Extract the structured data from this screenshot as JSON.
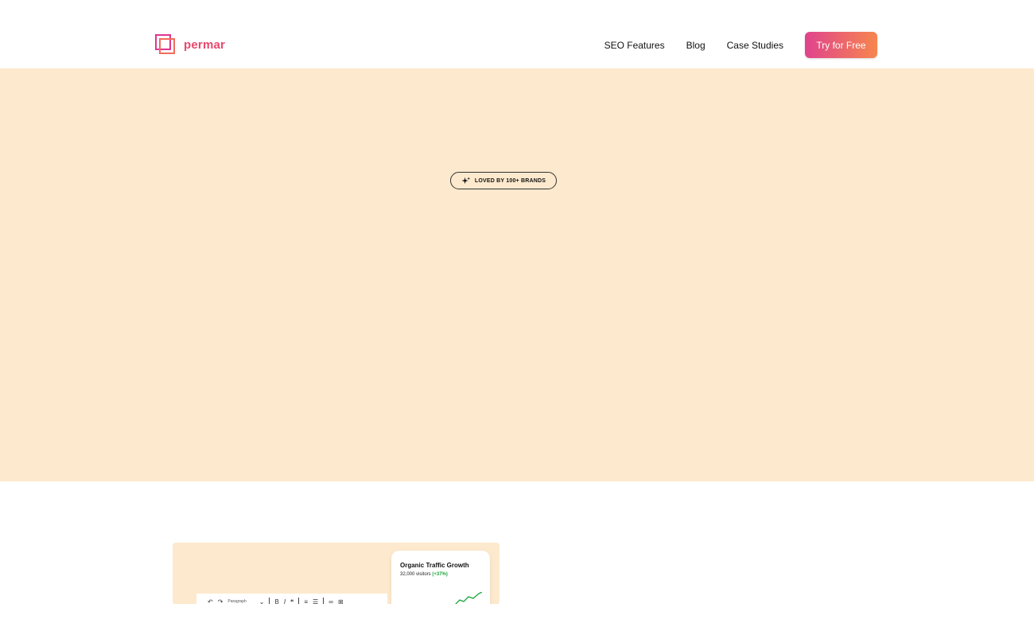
{
  "header": {
    "logo_text": "permar",
    "nav": [
      {
        "label": "SEO Features"
      },
      {
        "label": "Blog"
      },
      {
        "label": "Case Studies"
      }
    ],
    "cta_label": "Try for Free"
  },
  "hero": {
    "badge_text": "LOVED BY 100+ BRANDS",
    "background": "#fde9cd"
  },
  "feature": {
    "traffic_title": "Organic Traffic Growth",
    "traffic_visitors": "32,000 visitors",
    "traffic_change": "(+37%)",
    "toolbar_select": "Paragraph"
  },
  "colors": {
    "brand_pink": "#e0438c",
    "brand_orange": "#f6864e",
    "growth_green": "#1aa33a"
  }
}
